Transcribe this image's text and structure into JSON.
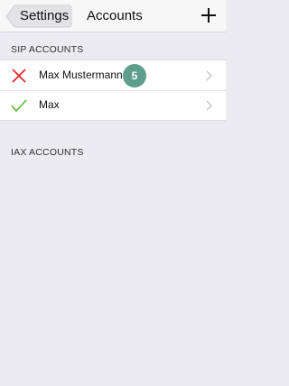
{
  "navbar": {
    "back_label": "Settings",
    "title": "Accounts",
    "add_icon": "plus-icon"
  },
  "sections": {
    "sip_header": "SIP ACCOUNTS",
    "iax_header": "IAX ACCOUNTS"
  },
  "accounts": [
    {
      "name": "Max Mustermann",
      "status": "unregistered",
      "status_icon": "x-mark-icon",
      "status_color": "#e8242b",
      "badge": "5"
    },
    {
      "name": "Max",
      "status": "registered",
      "status_icon": "checkmark-icon",
      "status_color": "#6cc04a"
    }
  ],
  "colors": {
    "background": "#ebebf0",
    "badge": "#5f9d8c",
    "chevron": "#c7c7cc"
  }
}
